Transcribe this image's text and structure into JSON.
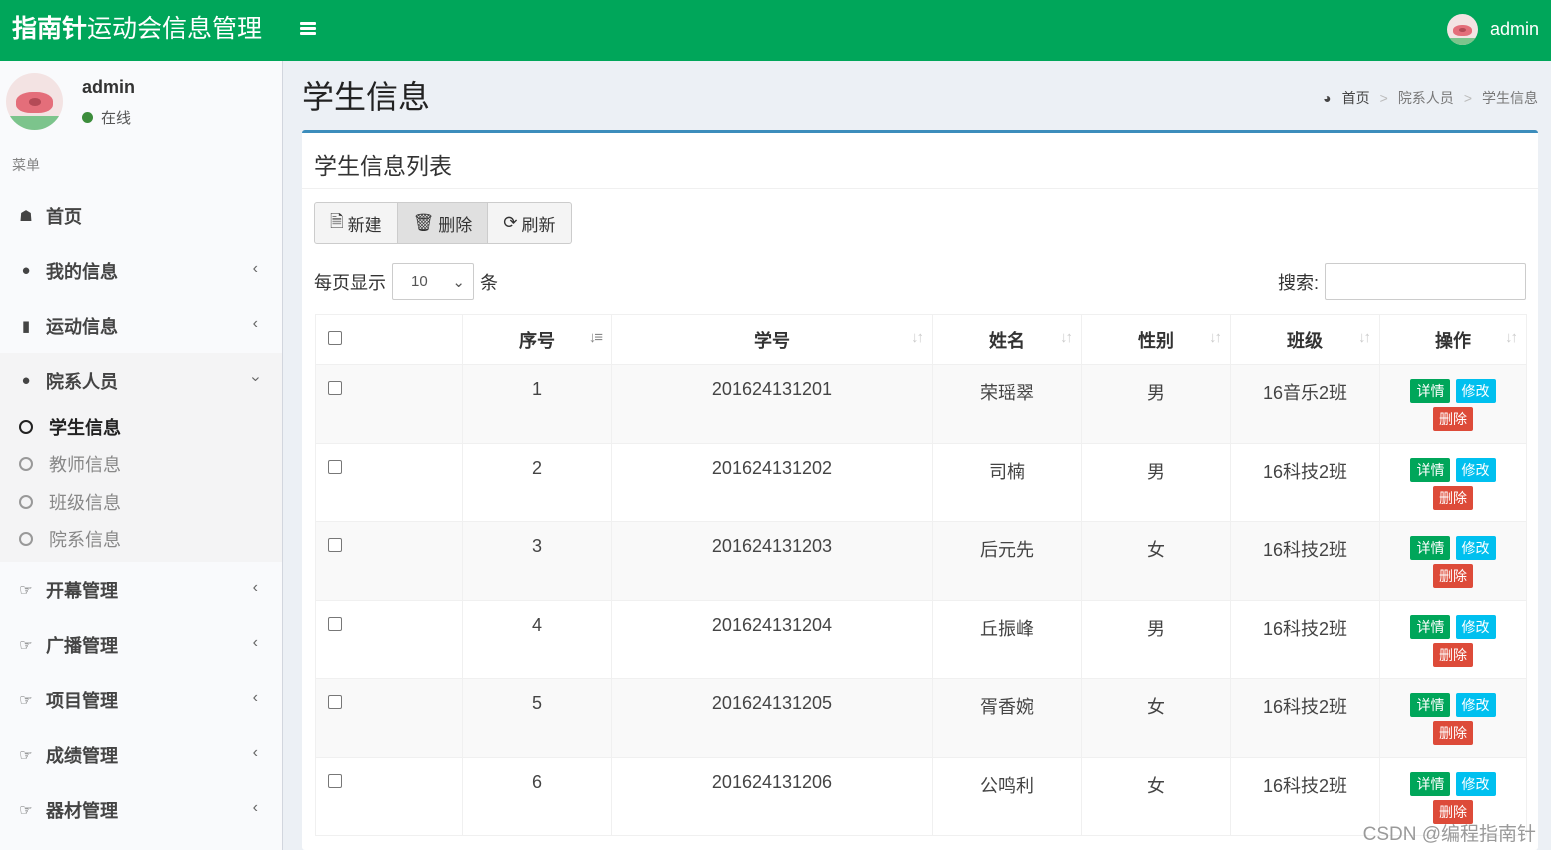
{
  "header": {
    "brand_bold": "指南针",
    "brand_rest": "运动会信息管理",
    "user": "admin"
  },
  "sidebar": {
    "user_name": "admin",
    "status": "在线",
    "menu_header": "菜单",
    "items": [
      {
        "label": "首页",
        "icon": "home-icon"
      },
      {
        "label": "我的信息",
        "icon": "user-icon"
      },
      {
        "label": "运动信息",
        "icon": "bar-chart-icon"
      },
      {
        "label": "院系人员",
        "icon": "users-icon"
      },
      {
        "label": "开幕管理",
        "icon": "hand-point-icon"
      },
      {
        "label": "广播管理",
        "icon": "hand-point-icon"
      },
      {
        "label": "项目管理",
        "icon": "hand-point-icon"
      },
      {
        "label": "成绩管理",
        "icon": "hand-point-icon"
      },
      {
        "label": "器材管理",
        "icon": "hand-point-icon"
      }
    ],
    "subitems": [
      "学生信息",
      "教师信息",
      "班级信息",
      "院系信息"
    ]
  },
  "page": {
    "title": "学生信息"
  },
  "breadcrumb": [
    "首页",
    "院系人员",
    "学生信息"
  ],
  "box": {
    "title": "学生信息列表"
  },
  "toolbar": {
    "new": "新建",
    "delete": "删除",
    "refresh": "刷新"
  },
  "length": {
    "prefix": "每页显示",
    "value": "10",
    "suffix": "条"
  },
  "search": {
    "label": "搜索:"
  },
  "table": {
    "headers": [
      "序号",
      "学号",
      "姓名",
      "性别",
      "班级",
      "操作"
    ],
    "rows": [
      {
        "no": "1",
        "id": "201624131201",
        "name": "荣瑶翠",
        "gender": "男",
        "class": "16音乐2班"
      },
      {
        "no": "2",
        "id": "201624131202",
        "name": "司楠",
        "gender": "男",
        "class": "16科技2班"
      },
      {
        "no": "3",
        "id": "201624131203",
        "name": "后元先",
        "gender": "女",
        "class": "16科技2班"
      },
      {
        "no": "4",
        "id": "201624131204",
        "name": "丘振峰",
        "gender": "男",
        "class": "16科技2班"
      },
      {
        "no": "5",
        "id": "201624131205",
        "name": "胥香婉",
        "gender": "女",
        "class": "16科技2班"
      },
      {
        "no": "6",
        "id": "201624131206",
        "name": "公鸣利",
        "gender": "女",
        "class": "16科技2班"
      }
    ],
    "actions": {
      "detail": "详情",
      "edit": "修改",
      "delete": "删除"
    }
  },
  "watermark": "CSDN @编程指南针",
  "colors": {
    "header": "#00a65a",
    "box_top": "#3c8dbc",
    "detail": "#00a65a",
    "edit": "#00c0ef",
    "delete": "#dd4b39"
  }
}
